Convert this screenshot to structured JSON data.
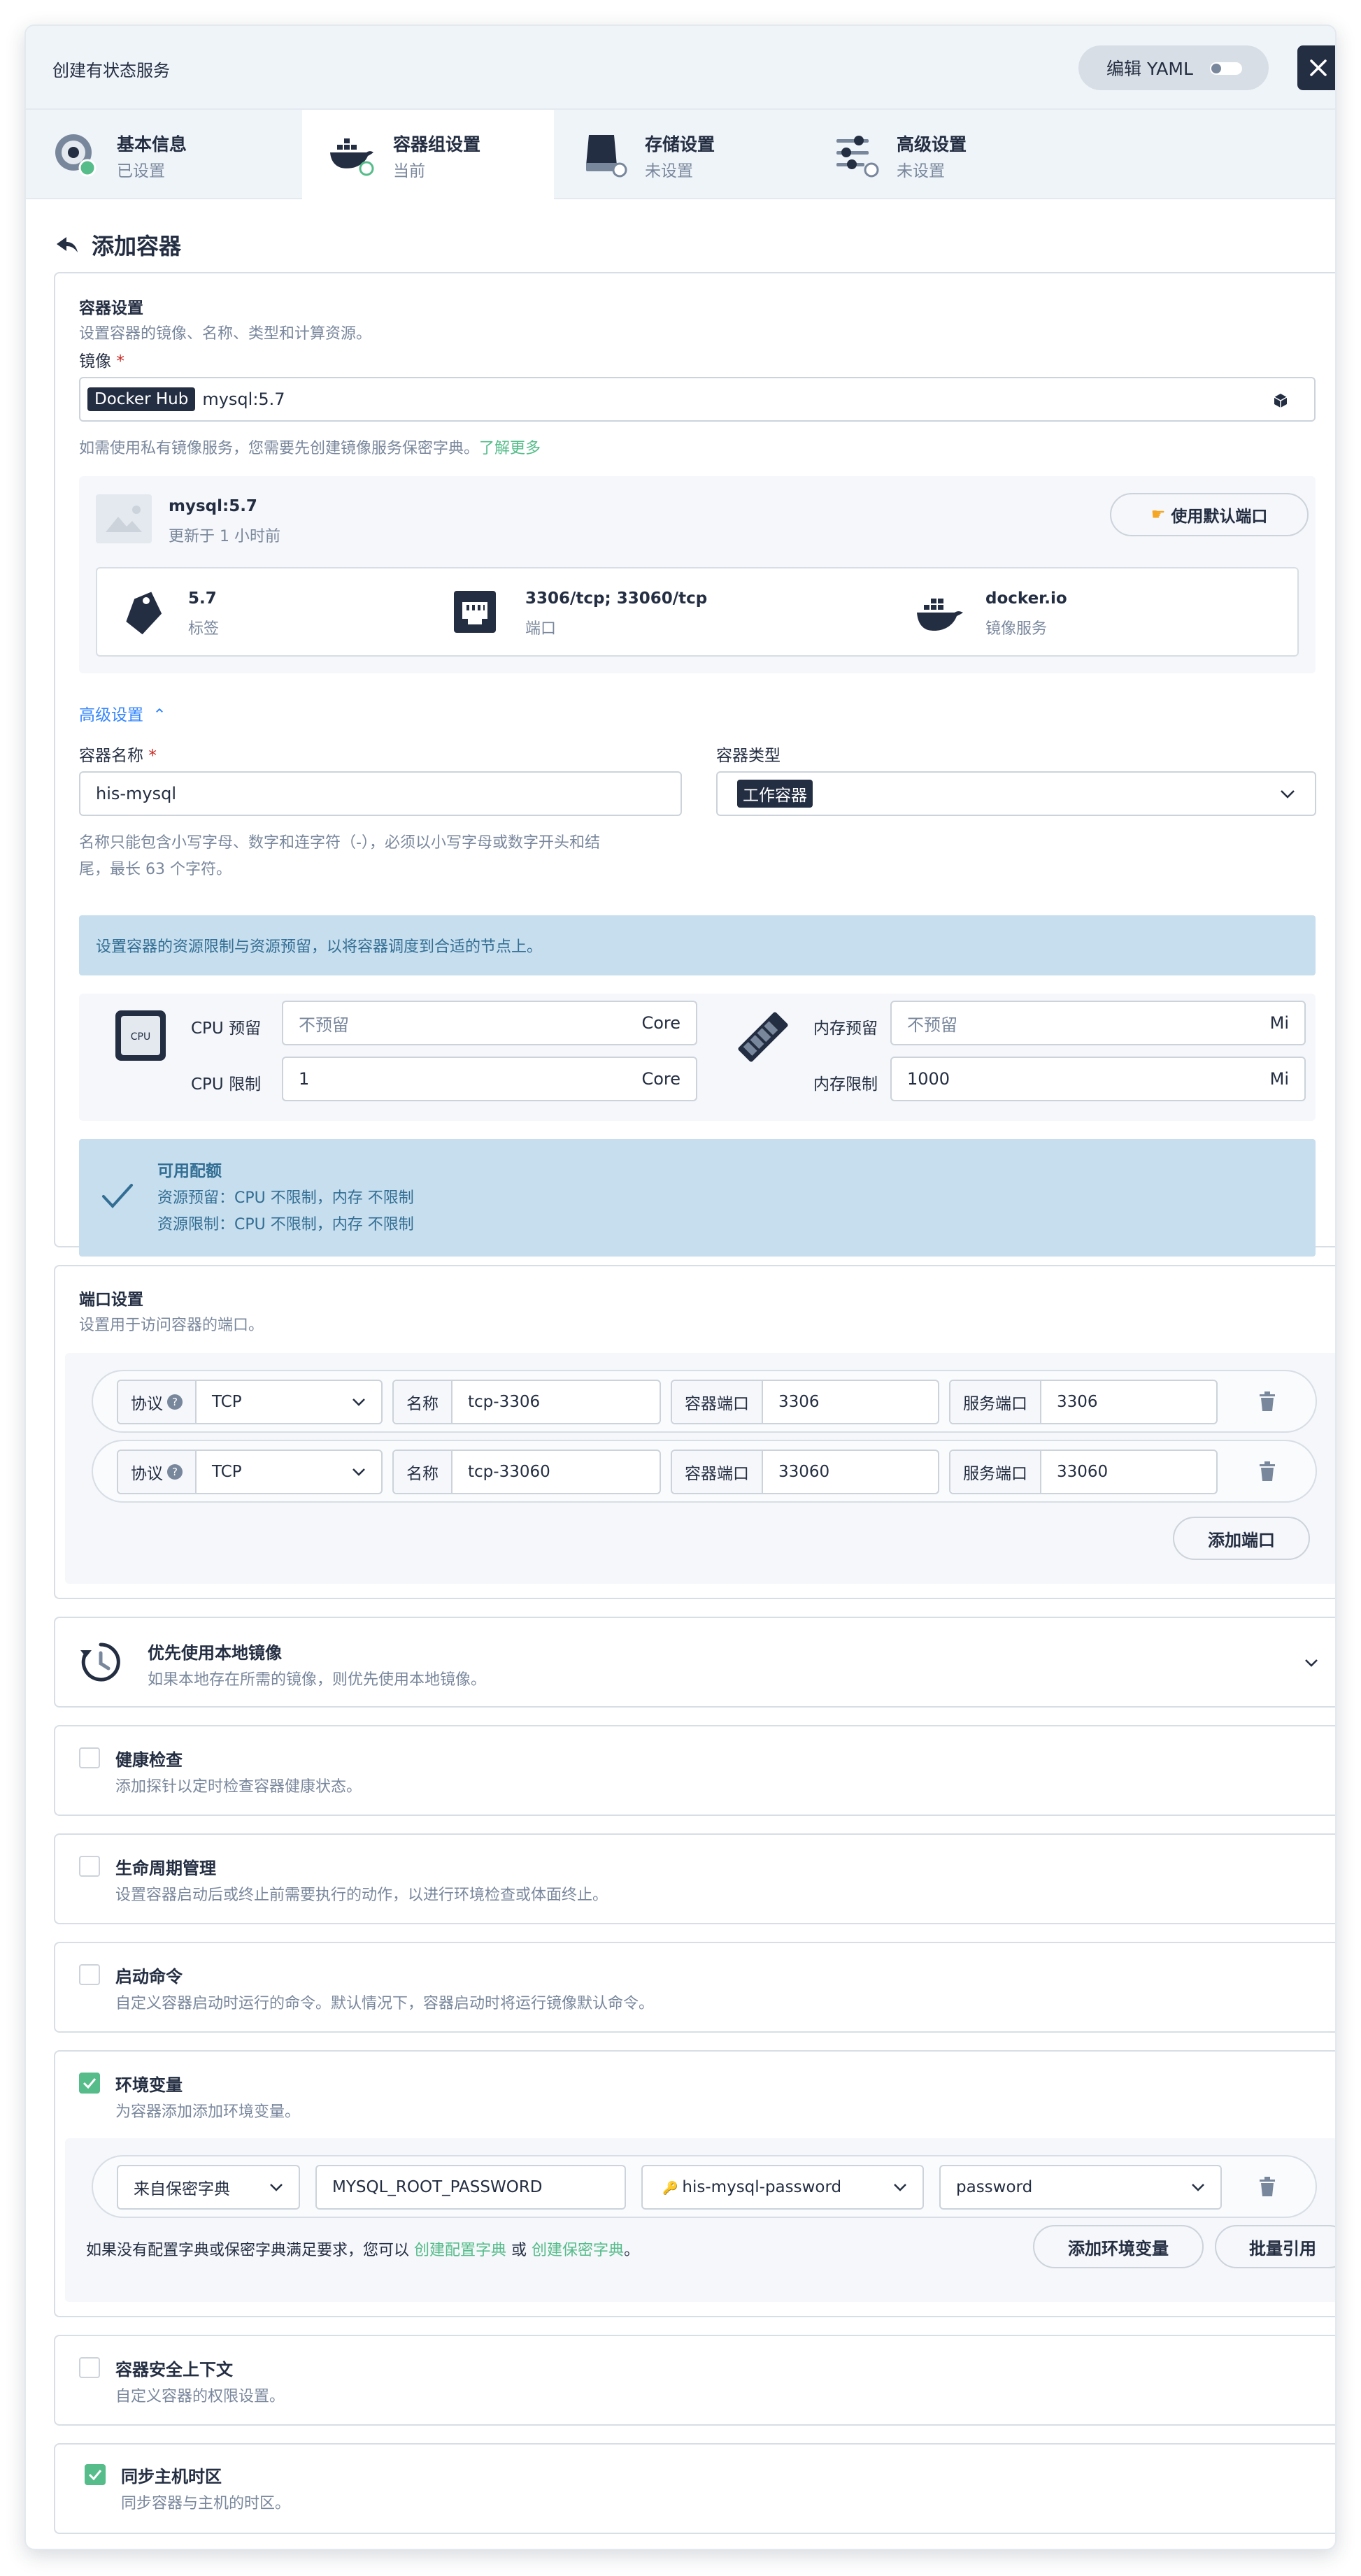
{
  "header": {
    "title": "创建有状态服务",
    "edit_yaml": "编辑 YAML"
  },
  "tabs": [
    {
      "title": "基本信息",
      "status": "已设置"
    },
    {
      "title": "容器组设置",
      "status": "当前"
    },
    {
      "title": "存储设置",
      "status": "未设置"
    },
    {
      "title": "高级设置",
      "status": "未设置"
    }
  ],
  "page_title": "添加容器",
  "container_settings": {
    "title": "容器设置",
    "desc": "设置容器的镜像、名称、类型和计算资源。",
    "image_label": "镜像",
    "required_mark": "*",
    "registry_tag": "Docker Hub",
    "image_value": "mysql:5.7",
    "private_hint": "如需使用私有镜像服务，您需要先创建镜像服务保密字典。",
    "learn_more": "了解更多",
    "image_card": {
      "name": "mysql:5.7",
      "updated": "更新于 1 小时前",
      "use_default_ports": "使用默认端口",
      "tag_value": "5.7",
      "tag_label": "标签",
      "ports_value": "3306/tcp; 33060/tcp",
      "ports_label": "端口",
      "registry_value": "docker.io",
      "registry_label": "镜像服务"
    },
    "advanced_toggle": "高级设置",
    "name_label": "容器名称",
    "name_value": "his-mysql",
    "name_hint_1": "名称只能包含小写字母、数字和连字符（-），必须以小写字母或数字开头和结",
    "name_hint_2": "尾，最长 63 个字符。",
    "type_label": "容器类型",
    "type_value": "工作容器",
    "resource_info": "设置容器的资源限制与资源预留，以将容器调度到合适的节点上。",
    "cpu_reserve_label": "CPU 预留",
    "cpu_reserve_placeholder": "不预留",
    "cpu_unit": "Core",
    "cpu_limit_label": "CPU 限制",
    "cpu_limit_value": "1",
    "mem_reserve_label": "内存预留",
    "mem_reserve_placeholder": "不预留",
    "mem_unit": "Mi",
    "mem_limit_label": "内存限制",
    "mem_limit_value": "1000",
    "quota_title": "可用配额",
    "quota_reserve": "资源预留：CPU 不限制，内存 不限制",
    "quota_limit": "资源限制：CPU 不限制，内存 不限制",
    "cpu_chip_text": "CPU"
  },
  "port_settings": {
    "title": "端口设置",
    "desc": "设置用于访问容器的端口。",
    "protocol_label": "协议",
    "name_label": "名称",
    "container_port_label": "容器端口",
    "service_port_label": "服务端口",
    "rows": [
      {
        "protocol": "TCP",
        "name": "tcp-3306",
        "container_port": "3306",
        "service_port": "3306"
      },
      {
        "protocol": "TCP",
        "name": "tcp-33060",
        "container_port": "33060",
        "service_port": "33060"
      }
    ],
    "add_port": "添加端口"
  },
  "local_image": {
    "title": "优先使用本地镜像",
    "desc": "如果本地存在所需的镜像，则优先使用本地镜像。"
  },
  "health_check": {
    "title": "健康检查",
    "desc": "添加探针以定时检查容器健康状态。",
    "checked": false
  },
  "lifecycle": {
    "title": "生命周期管理",
    "desc": "设置容器启动后或终止前需要执行的动作，以进行环境检查或体面终止。",
    "checked": false
  },
  "start_command": {
    "title": "启动命令",
    "desc": "自定义容器启动时运行的命令。默认情况下，容器启动时将运行镜像默认命令。",
    "checked": false
  },
  "env_vars": {
    "title": "环境变量",
    "desc": "为容器添加添加环境变量。",
    "checked": true,
    "row": {
      "source": "来自保密字典",
      "key": "MYSQL_ROOT_PASSWORD",
      "secret": "his-mysql-password",
      "secret_key": "password"
    },
    "hint_prefix": "如果没有配置字典或保密字典满足要求，您可以",
    "create_configmap": "创建配置字典",
    "hint_or": "或",
    "create_secret": "创建保密字典",
    "hint_suffix": "。",
    "add_env": "添加环境变量",
    "batch_ref": "批量引用"
  },
  "security_context": {
    "title": "容器安全上下文",
    "desc": "自定义容器的权限设置。",
    "checked": false
  },
  "sync_timezone": {
    "title": "同步主机时区",
    "desc": "同步容器与主机的时区。",
    "checked": true
  },
  "colors": {
    "accent_green": "#55bc8a",
    "dark": "#242e42",
    "info_blue": "#c7deef"
  }
}
